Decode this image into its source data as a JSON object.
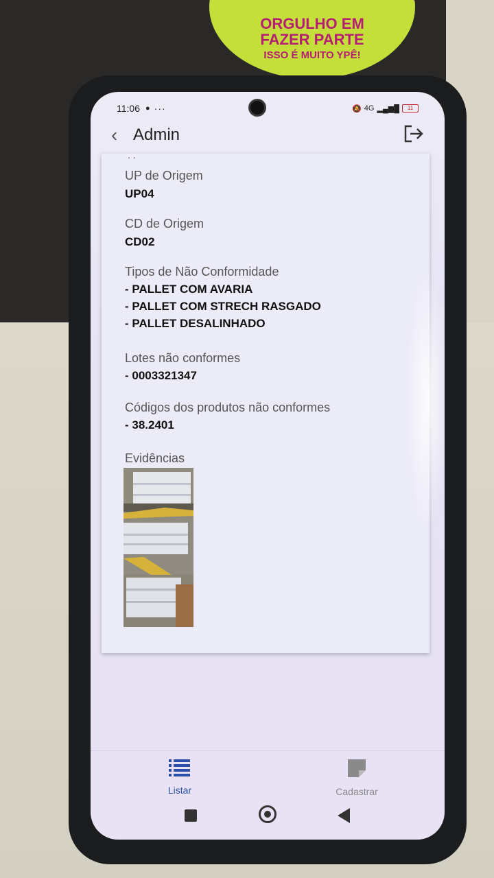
{
  "sticker": {
    "line1": "ORGULHO EM",
    "line2": "FAZER PARTE",
    "line3": "ISSO É MUITO YPÊ!"
  },
  "status_bar": {
    "time": "11:06",
    "dots": "···",
    "network": "4G",
    "battery": "11"
  },
  "header": {
    "title": "Admin",
    "back_icon": "chevron-left-icon",
    "logout_icon": "logout-icon"
  },
  "details": {
    "truncated_marker": ". .",
    "up_origem": {
      "label": "UP de Origem",
      "value": "UP04"
    },
    "cd_origem": {
      "label": "CD de Origem",
      "value": "CD02"
    },
    "tipos": {
      "label": "Tipos de Não Conformidade",
      "items": [
        "- PALLET COM AVARIA",
        "- PALLET COM STRECH RASGADO",
        "- PALLET DESALINHADO"
      ]
    },
    "lotes": {
      "label": "Lotes não conformes",
      "items": [
        "- 0003321347"
      ]
    },
    "codigos": {
      "label": "Códigos dos produtos não conformes",
      "items": [
        "- 38.2401"
      ]
    },
    "evidencias": {
      "label": "Evidências"
    }
  },
  "bottom_nav": {
    "listar": {
      "label": "Listar",
      "icon": "list-icon",
      "color": "#2a4fa8"
    },
    "cadastrar": {
      "label": "Cadastrar",
      "icon": "note-icon",
      "color": "#8a8a8a"
    }
  }
}
